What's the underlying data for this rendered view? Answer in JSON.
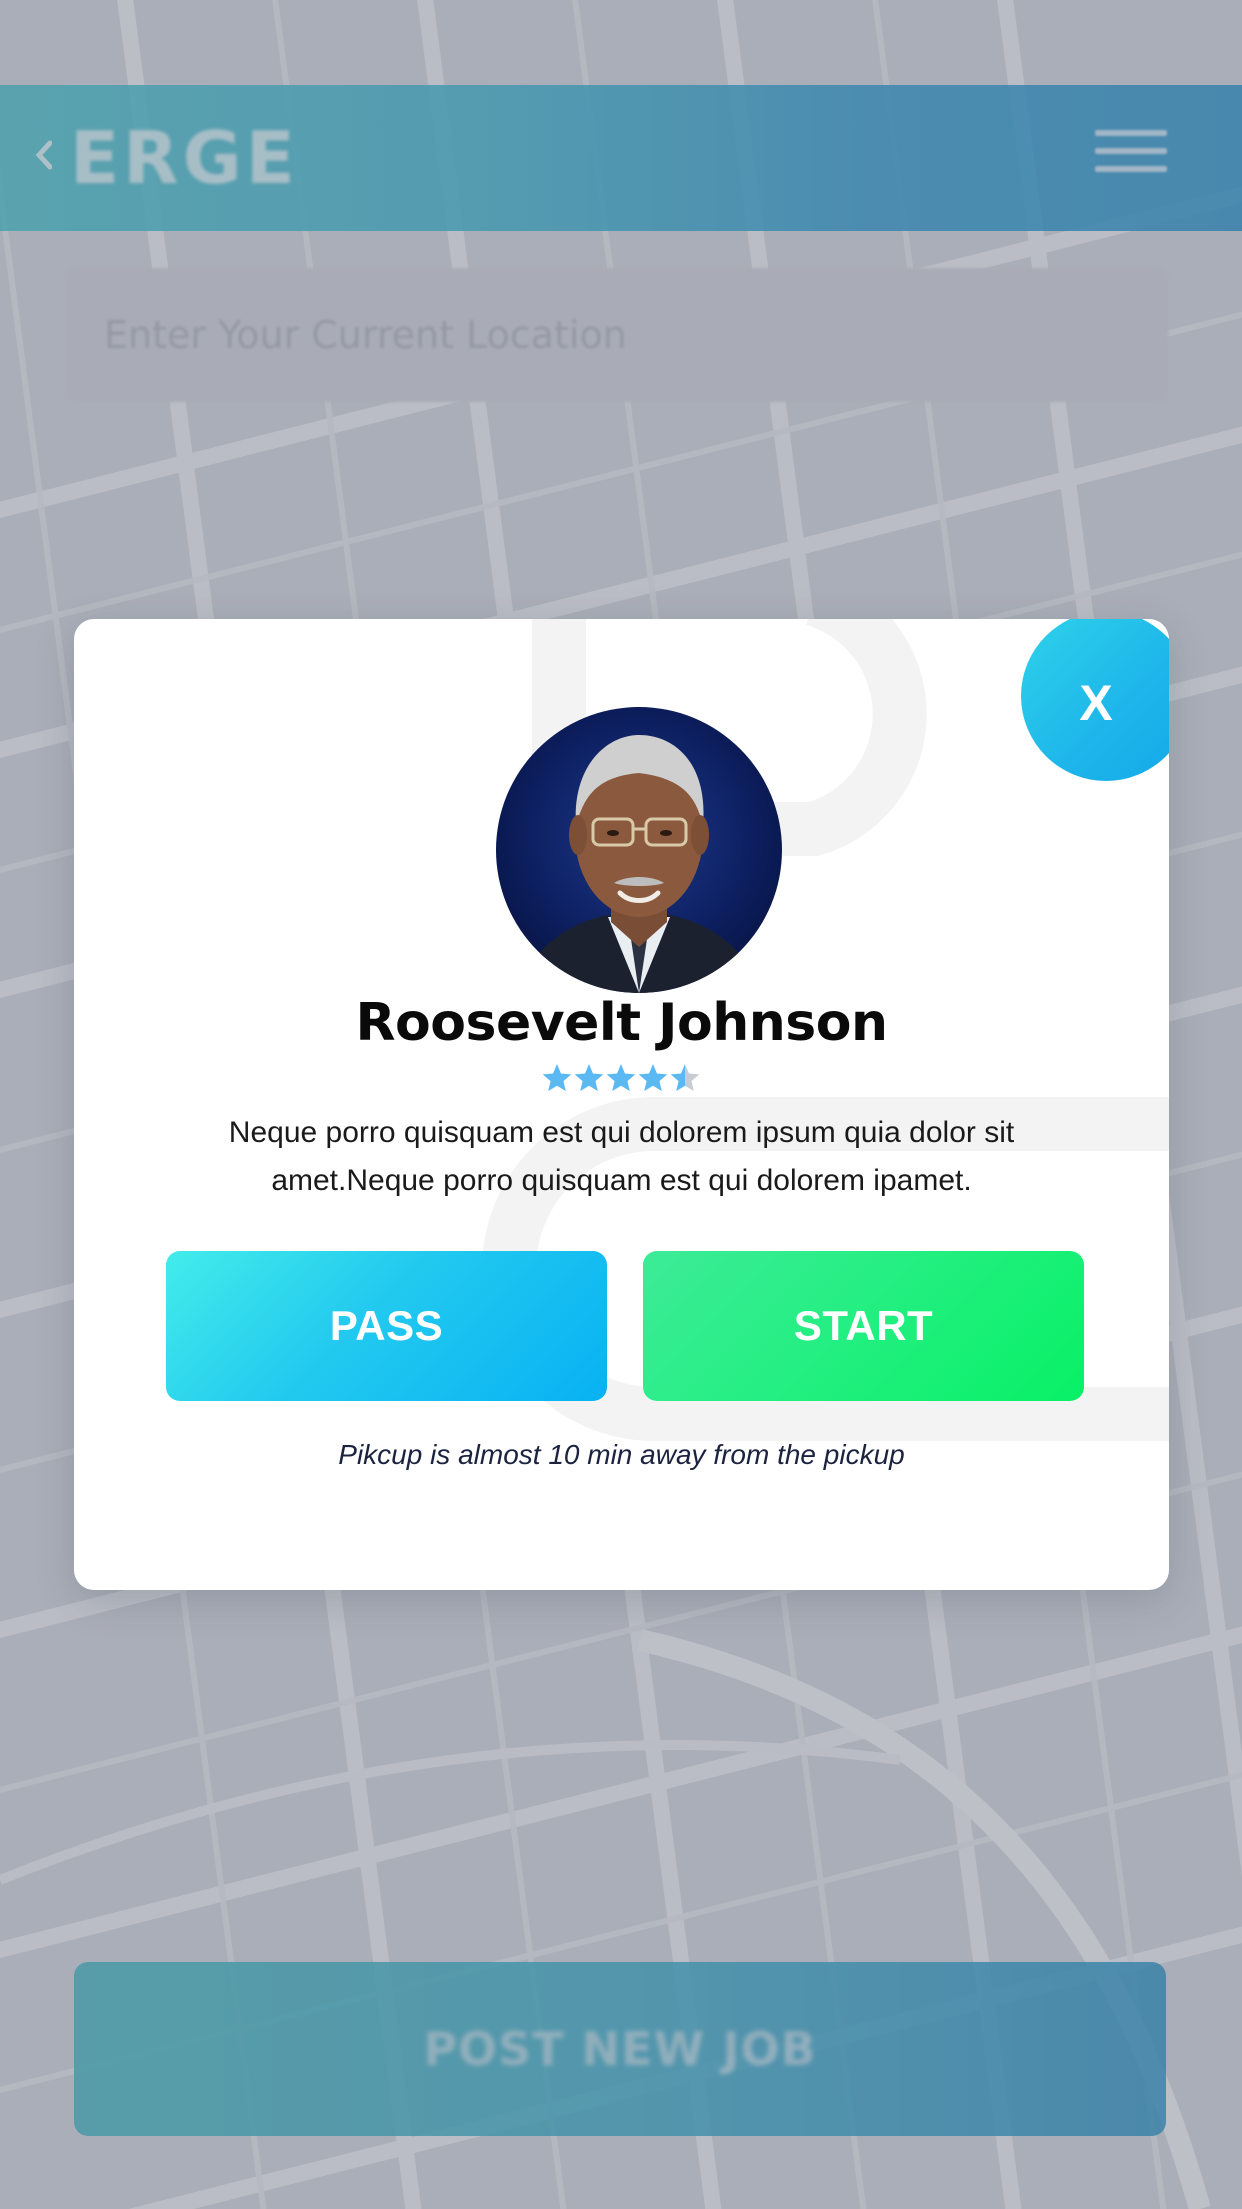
{
  "header": {
    "brand": "ERGE",
    "back_icon": "chevron-left-icon",
    "menu_icon": "hamburger-menu-icon"
  },
  "search": {
    "placeholder": "Enter Your Current Location"
  },
  "modal": {
    "close_label": "X",
    "driver": {
      "name": "Roosevelt  Johnson",
      "rating": 4.5,
      "rating_max": 5,
      "description": "Neque porro quisquam est qui dolorem ipsum quia dolor sit amet.Neque porro quisquam est qui dolorem ipamet."
    },
    "pass_label": "PASS",
    "start_label": "START",
    "note": "Pikcup is almost 10 min away from the pickup"
  },
  "footer": {
    "post_job_label": "POST NEW JOB"
  },
  "colors": {
    "star_active": "#5ab9f2",
    "star_inactive": "#c9cdd3",
    "pass_gradient": [
      "#43ecea",
      "#08b2f3"
    ],
    "start_gradient": [
      "#3deb98",
      "#08f066"
    ],
    "header_gradient": [
      "#34b3bf",
      "#1584be"
    ]
  }
}
